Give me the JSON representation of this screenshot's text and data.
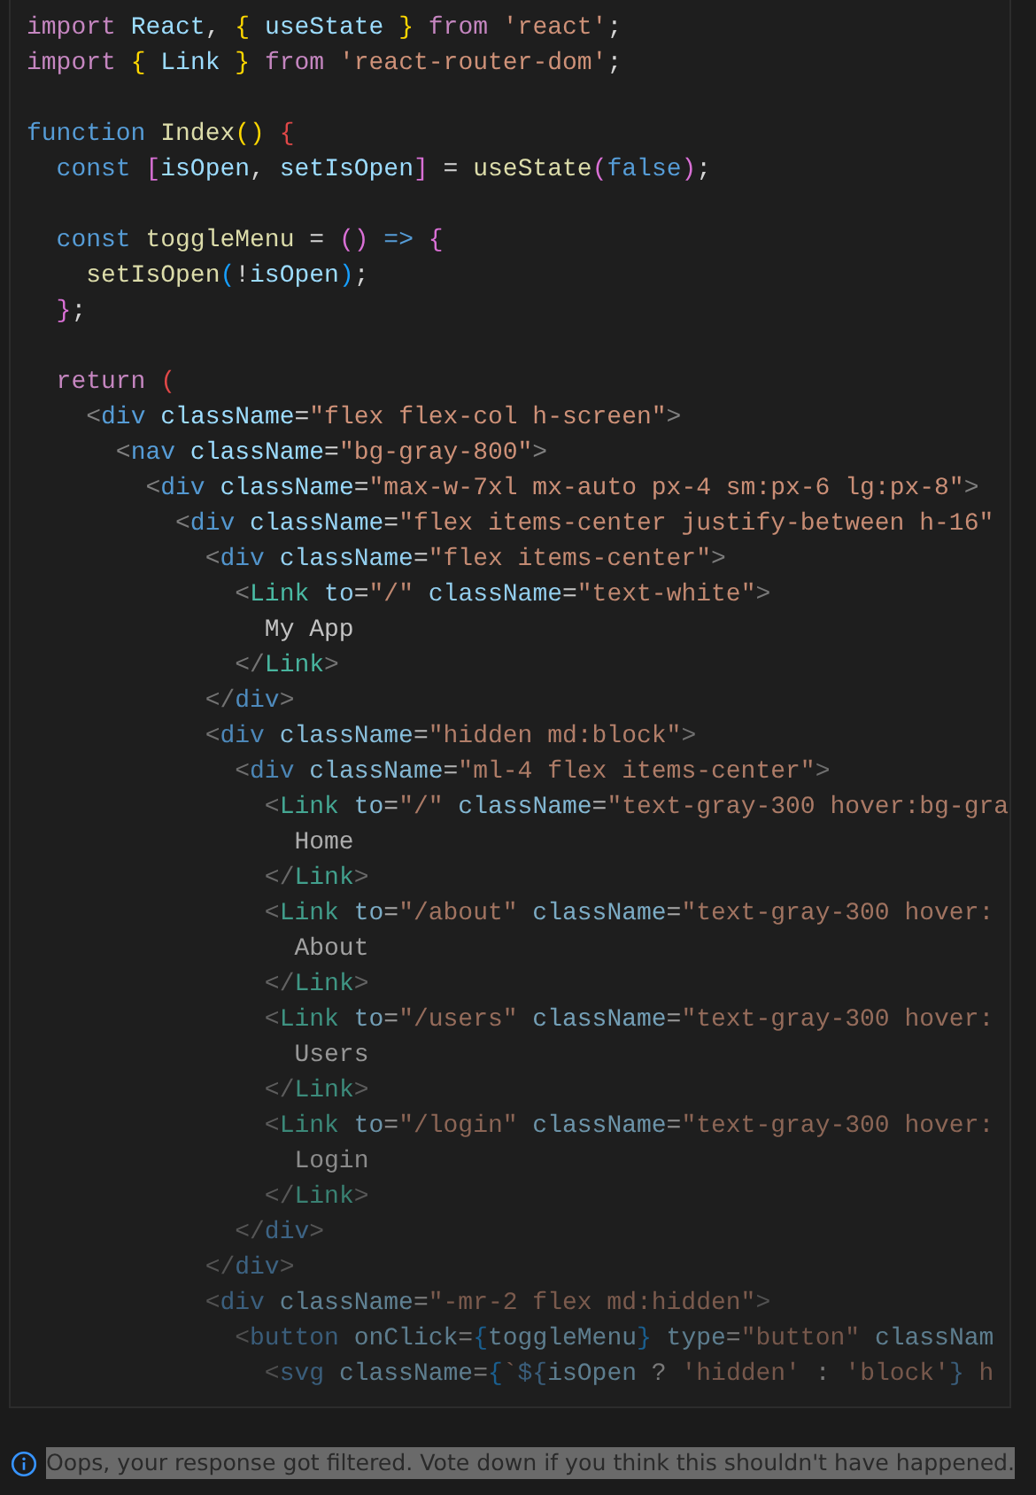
{
  "code_block": {
    "lines": [
      {
        "kind": "code",
        "tokens": [
          {
            "kind": "kw2",
            "text": "import"
          },
          {
            "kind": "var",
            "text": " React"
          },
          {
            "kind": "punc",
            "text": ", "
          },
          {
            "kind": "br1",
            "text": "{"
          },
          {
            "kind": "var",
            "text": " useState "
          },
          {
            "kind": "br1",
            "text": "}"
          },
          {
            "kind": "kw2",
            "text": " from"
          },
          {
            "kind": "str",
            "text": " 'react'"
          },
          {
            "kind": "punc",
            "text": ";"
          }
        ]
      },
      {
        "kind": "code",
        "tokens": [
          {
            "kind": "kw2",
            "text": "import"
          },
          {
            "kind": "br1",
            "text": " {"
          },
          {
            "kind": "var",
            "text": " Link "
          },
          {
            "kind": "br1",
            "text": "}"
          },
          {
            "kind": "kw2",
            "text": " from"
          },
          {
            "kind": "str",
            "text": " 'react-router-dom'"
          },
          {
            "kind": "punc",
            "text": ";"
          }
        ]
      },
      {
        "kind": "blank"
      },
      {
        "kind": "code",
        "tokens": [
          {
            "kind": "kw",
            "text": "function"
          },
          {
            "kind": "fn",
            "text": " Index"
          },
          {
            "kind": "br1",
            "text": "()"
          },
          {
            "kind": "err",
            "text": " {"
          }
        ]
      },
      {
        "kind": "code",
        "tokens": [
          {
            "kind": "kw",
            "text": "  const"
          },
          {
            "kind": "br2",
            "text": " ["
          },
          {
            "kind": "var",
            "text": "isOpen"
          },
          {
            "kind": "punc",
            "text": ", "
          },
          {
            "kind": "var",
            "text": "setIsOpen"
          },
          {
            "kind": "br2",
            "text": "]"
          },
          {
            "kind": "punc",
            "text": " = "
          },
          {
            "kind": "fn",
            "text": "useState"
          },
          {
            "kind": "br2",
            "text": "("
          },
          {
            "kind": "kw",
            "text": "false"
          },
          {
            "kind": "br2",
            "text": ")"
          },
          {
            "kind": "punc",
            "text": ";"
          }
        ]
      },
      {
        "kind": "blank"
      },
      {
        "kind": "code",
        "tokens": [
          {
            "kind": "kw",
            "text": "  const"
          },
          {
            "kind": "fn",
            "text": " toggleMenu"
          },
          {
            "kind": "punc",
            "text": " = "
          },
          {
            "kind": "br2",
            "text": "()"
          },
          {
            "kind": "kw",
            "text": " =>"
          },
          {
            "kind": "br2",
            "text": " {"
          }
        ]
      },
      {
        "kind": "code",
        "tokens": [
          {
            "kind": "fn",
            "text": "    setIsOpen"
          },
          {
            "kind": "br3",
            "text": "("
          },
          {
            "kind": "punc",
            "text": "!"
          },
          {
            "kind": "var",
            "text": "isOpen"
          },
          {
            "kind": "br3",
            "text": ")"
          },
          {
            "kind": "punc",
            "text": ";"
          }
        ]
      },
      {
        "kind": "code",
        "tokens": [
          {
            "kind": "br2",
            "text": "  }"
          },
          {
            "kind": "punc",
            "text": ";"
          }
        ]
      },
      {
        "kind": "blank"
      },
      {
        "kind": "code",
        "tokens": [
          {
            "kind": "kw2",
            "text": "  return"
          },
          {
            "kind": "err",
            "text": " ("
          }
        ]
      },
      {
        "kind": "code",
        "tokens": [
          {
            "kind": "tagp",
            "text": "    <"
          },
          {
            "kind": "tag",
            "text": "div"
          },
          {
            "kind": "attr",
            "text": " className"
          },
          {
            "kind": "punc",
            "text": "="
          },
          {
            "kind": "str",
            "text": "\"flex flex-col h-screen\""
          },
          {
            "kind": "tagp",
            "text": ">"
          }
        ]
      },
      {
        "kind": "code",
        "tokens": [
          {
            "kind": "tagp",
            "text": "      <"
          },
          {
            "kind": "tag",
            "text": "nav"
          },
          {
            "kind": "attr",
            "text": " className"
          },
          {
            "kind": "punc",
            "text": "="
          },
          {
            "kind": "str",
            "text": "\"bg-gray-800\""
          },
          {
            "kind": "tagp",
            "text": ">"
          }
        ]
      },
      {
        "kind": "code",
        "tokens": [
          {
            "kind": "tagp",
            "text": "        <"
          },
          {
            "kind": "tag",
            "text": "div"
          },
          {
            "kind": "attr",
            "text": " className"
          },
          {
            "kind": "punc",
            "text": "="
          },
          {
            "kind": "str",
            "text": "\"max-w-7xl mx-auto px-4 sm:px-6 lg:px-8\""
          },
          {
            "kind": "tagp",
            "text": ">"
          }
        ]
      },
      {
        "kind": "code",
        "tokens": [
          {
            "kind": "tagp",
            "text": "          <"
          },
          {
            "kind": "tag",
            "text": "div"
          },
          {
            "kind": "attr",
            "text": " className"
          },
          {
            "kind": "punc",
            "text": "="
          },
          {
            "kind": "str",
            "text": "\"flex items-center justify-between h-16\""
          }
        ]
      },
      {
        "kind": "code",
        "tokens": [
          {
            "kind": "tagp",
            "text": "            <"
          },
          {
            "kind": "tag",
            "text": "div"
          },
          {
            "kind": "attr",
            "text": " className"
          },
          {
            "kind": "punc",
            "text": "="
          },
          {
            "kind": "str",
            "text": "\"flex items-center\""
          },
          {
            "kind": "tagp",
            "text": ">"
          }
        ]
      },
      {
        "kind": "code",
        "tokens": [
          {
            "kind": "tagp",
            "text": "              <"
          },
          {
            "kind": "comp",
            "text": "Link"
          },
          {
            "kind": "attr",
            "text": " to"
          },
          {
            "kind": "punc",
            "text": "="
          },
          {
            "kind": "str",
            "text": "\"/\""
          },
          {
            "kind": "attr",
            "text": " className"
          },
          {
            "kind": "punc",
            "text": "="
          },
          {
            "kind": "str",
            "text": "\"text-white\""
          },
          {
            "kind": "tagp",
            "text": ">"
          }
        ]
      },
      {
        "kind": "code",
        "tokens": [
          {
            "kind": "text",
            "text": "                My App"
          }
        ]
      },
      {
        "kind": "code",
        "tokens": [
          {
            "kind": "tagp",
            "text": "              </"
          },
          {
            "kind": "comp",
            "text": "Link"
          },
          {
            "kind": "tagp",
            "text": ">"
          }
        ]
      },
      {
        "kind": "code",
        "tokens": [
          {
            "kind": "tagp",
            "text": "            </"
          },
          {
            "kind": "tag",
            "text": "div"
          },
          {
            "kind": "tagp",
            "text": ">"
          }
        ]
      },
      {
        "kind": "code",
        "tokens": [
          {
            "kind": "tagp",
            "text": "            <"
          },
          {
            "kind": "tag",
            "text": "div"
          },
          {
            "kind": "attr",
            "text": " className"
          },
          {
            "kind": "punc",
            "text": "="
          },
          {
            "kind": "str",
            "text": "\"hidden md:block\""
          },
          {
            "kind": "tagp",
            "text": ">"
          }
        ]
      },
      {
        "kind": "code",
        "tokens": [
          {
            "kind": "tagp",
            "text": "              <"
          },
          {
            "kind": "tag",
            "text": "div"
          },
          {
            "kind": "attr",
            "text": " className"
          },
          {
            "kind": "punc",
            "text": "="
          },
          {
            "kind": "str",
            "text": "\"ml-4 flex items-center\""
          },
          {
            "kind": "tagp",
            "text": ">"
          }
        ]
      },
      {
        "kind": "code",
        "tokens": [
          {
            "kind": "tagp",
            "text": "                <"
          },
          {
            "kind": "comp",
            "text": "Link"
          },
          {
            "kind": "attr",
            "text": " to"
          },
          {
            "kind": "punc",
            "text": "="
          },
          {
            "kind": "str",
            "text": "\"/\""
          },
          {
            "kind": "attr",
            "text": " className"
          },
          {
            "kind": "punc",
            "text": "="
          },
          {
            "kind": "str",
            "text": "\"text-gray-300 hover:bg-gra"
          }
        ]
      },
      {
        "kind": "code",
        "tokens": [
          {
            "kind": "text",
            "text": "                  Home"
          }
        ]
      },
      {
        "kind": "code",
        "tokens": [
          {
            "kind": "tagp",
            "text": "                </"
          },
          {
            "kind": "comp",
            "text": "Link"
          },
          {
            "kind": "tagp",
            "text": ">"
          }
        ]
      },
      {
        "kind": "code",
        "tokens": [
          {
            "kind": "tagp",
            "text": "                <"
          },
          {
            "kind": "comp",
            "text": "Link"
          },
          {
            "kind": "attr",
            "text": " to"
          },
          {
            "kind": "punc",
            "text": "="
          },
          {
            "kind": "str",
            "text": "\"/about\""
          },
          {
            "kind": "attr",
            "text": " className"
          },
          {
            "kind": "punc",
            "text": "="
          },
          {
            "kind": "str",
            "text": "\"text-gray-300 hover:"
          }
        ]
      },
      {
        "kind": "code",
        "tokens": [
          {
            "kind": "text",
            "text": "                  About"
          }
        ]
      },
      {
        "kind": "code",
        "tokens": [
          {
            "kind": "tagp",
            "text": "                </"
          },
          {
            "kind": "comp",
            "text": "Link"
          },
          {
            "kind": "tagp",
            "text": ">"
          }
        ]
      },
      {
        "kind": "code",
        "tokens": [
          {
            "kind": "tagp",
            "text": "                <"
          },
          {
            "kind": "comp",
            "text": "Link"
          },
          {
            "kind": "attr",
            "text": " to"
          },
          {
            "kind": "punc",
            "text": "="
          },
          {
            "kind": "str",
            "text": "\"/users\""
          },
          {
            "kind": "attr",
            "text": " className"
          },
          {
            "kind": "punc",
            "text": "="
          },
          {
            "kind": "str",
            "text": "\"text-gray-300 hover:"
          }
        ]
      },
      {
        "kind": "code",
        "tokens": [
          {
            "kind": "text",
            "text": "                  Users"
          }
        ]
      },
      {
        "kind": "code",
        "tokens": [
          {
            "kind": "tagp",
            "text": "                </"
          },
          {
            "kind": "comp",
            "text": "Link"
          },
          {
            "kind": "tagp",
            "text": ">"
          }
        ]
      },
      {
        "kind": "code",
        "tokens": [
          {
            "kind": "tagp",
            "text": "                <"
          },
          {
            "kind": "comp",
            "text": "Link"
          },
          {
            "kind": "attr",
            "text": " to"
          },
          {
            "kind": "punc",
            "text": "="
          },
          {
            "kind": "str",
            "text": "\"/login\""
          },
          {
            "kind": "attr",
            "text": " className"
          },
          {
            "kind": "punc",
            "text": "="
          },
          {
            "kind": "str",
            "text": "\"text-gray-300 hover:"
          }
        ]
      },
      {
        "kind": "code",
        "tokens": [
          {
            "kind": "text",
            "text": "                  Login"
          }
        ]
      },
      {
        "kind": "code",
        "tokens": [
          {
            "kind": "tagp",
            "text": "                </"
          },
          {
            "kind": "comp",
            "text": "Link"
          },
          {
            "kind": "tagp",
            "text": ">"
          }
        ]
      },
      {
        "kind": "code",
        "tokens": [
          {
            "kind": "tagp",
            "text": "              </"
          },
          {
            "kind": "tag",
            "text": "div"
          },
          {
            "kind": "tagp",
            "text": ">"
          }
        ]
      },
      {
        "kind": "code",
        "tokens": [
          {
            "kind": "tagp",
            "text": "            </"
          },
          {
            "kind": "tag",
            "text": "div"
          },
          {
            "kind": "tagp",
            "text": ">"
          }
        ]
      },
      {
        "kind": "code",
        "tokens": [
          {
            "kind": "tagp",
            "text": "            <"
          },
          {
            "kind": "tag",
            "text": "div"
          },
          {
            "kind": "attr",
            "text": " className"
          },
          {
            "kind": "punc",
            "text": "="
          },
          {
            "kind": "str",
            "text": "\"-mr-2 flex md:hidden\""
          },
          {
            "kind": "tagp",
            "text": ">"
          }
        ]
      },
      {
        "kind": "code",
        "tokens": [
          {
            "kind": "tagp",
            "text": "              <"
          },
          {
            "kind": "tag",
            "text": "button"
          },
          {
            "kind": "attr",
            "text": " onClick"
          },
          {
            "kind": "punc",
            "text": "="
          },
          {
            "kind": "br3",
            "text": "{"
          },
          {
            "kind": "var",
            "text": "toggleMenu"
          },
          {
            "kind": "br3",
            "text": "}"
          },
          {
            "kind": "attr",
            "text": " type"
          },
          {
            "kind": "punc",
            "text": "="
          },
          {
            "kind": "str",
            "text": "\"button\""
          },
          {
            "kind": "attr",
            "text": " classNam"
          }
        ]
      },
      {
        "kind": "code",
        "tokens": [
          {
            "kind": "tagp",
            "text": "                <"
          },
          {
            "kind": "tag",
            "text": "svg"
          },
          {
            "kind": "attr",
            "text": " className"
          },
          {
            "kind": "punc",
            "text": "="
          },
          {
            "kind": "br3",
            "text": "{"
          },
          {
            "kind": "str",
            "text": "`"
          },
          {
            "kind": "kw",
            "text": "${"
          },
          {
            "kind": "var",
            "text": "isOpen"
          },
          {
            "kind": "punc",
            "text": " ? "
          },
          {
            "kind": "str",
            "text": "'hidden'"
          },
          {
            "kind": "punc",
            "text": " : "
          },
          {
            "kind": "str",
            "text": "'block'"
          },
          {
            "kind": "kw",
            "text": "}"
          },
          {
            "kind": "str",
            "text": " h"
          }
        ]
      }
    ]
  },
  "notice": {
    "text": "Oops, your response got filtered. Vote down if you think this shouldn't have happened."
  }
}
